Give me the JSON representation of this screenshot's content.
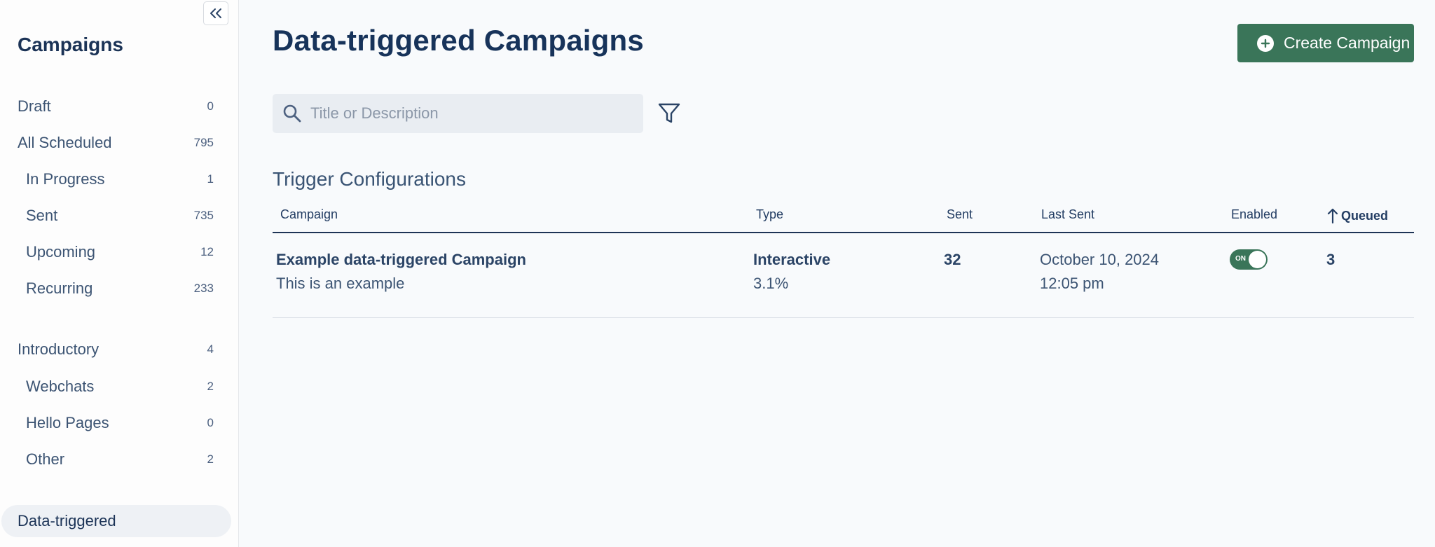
{
  "sidebar": {
    "title": "Campaigns",
    "items": [
      {
        "label": "Draft",
        "count": "0"
      },
      {
        "label": "All Scheduled",
        "count": "795"
      },
      {
        "label": "In Progress",
        "count": "1"
      },
      {
        "label": "Sent",
        "count": "735"
      },
      {
        "label": "Upcoming",
        "count": "12"
      },
      {
        "label": "Recurring",
        "count": "233"
      },
      {
        "label": "Introductory",
        "count": "4"
      },
      {
        "label": "Webchats",
        "count": "2"
      },
      {
        "label": "Hello Pages",
        "count": "0"
      },
      {
        "label": "Other",
        "count": "2"
      },
      {
        "label": "Data-triggered"
      }
    ]
  },
  "main": {
    "title": "Data-triggered Campaigns",
    "create_button": "Create Campaign",
    "search_placeholder": "Title or Description",
    "section_title": "Trigger Configurations",
    "columns": [
      "Campaign",
      "Type",
      "Sent",
      "Last Sent",
      "Enabled",
      "Queued"
    ],
    "rows": [
      {
        "campaign": "Example data-triggered Campaign",
        "description": "This is an example",
        "type": "Interactive",
        "rate": "3.1%",
        "sent": "32",
        "last_sent_date": "October 10, 2024",
        "last_sent_time": "12:05 pm",
        "toggle": "ON",
        "queued": "3"
      }
    ]
  },
  "colors": {
    "accent": "#3a7559",
    "text": "#17335a"
  }
}
